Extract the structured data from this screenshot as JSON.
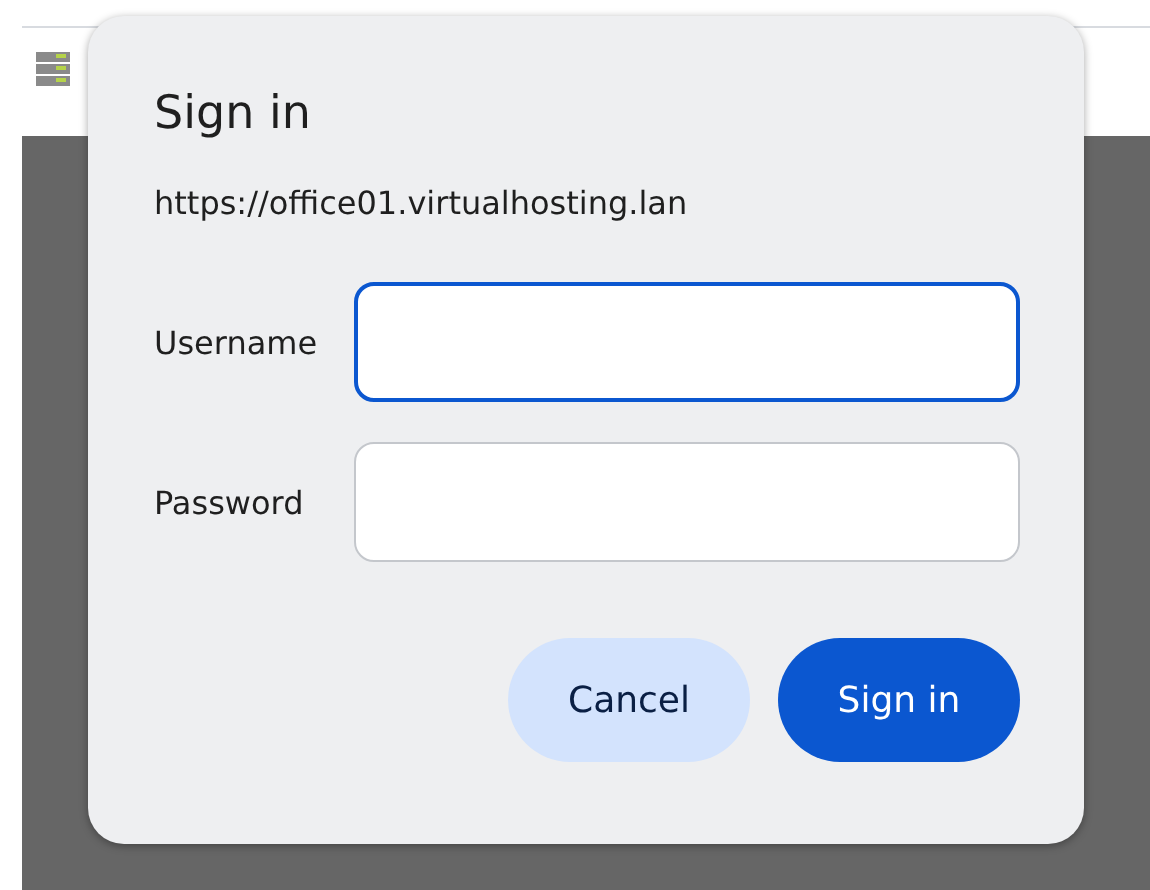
{
  "dialog": {
    "title": "Sign in",
    "origin": "https://office01.virtualhosting.lan",
    "fields": [
      {
        "label": "Username",
        "focused": true
      },
      {
        "label": "Password",
        "focused": false
      }
    ],
    "buttons": [
      {
        "label": "Cancel",
        "kind": "secondary"
      },
      {
        "label": "Sign in",
        "kind": "primary"
      }
    ]
  }
}
